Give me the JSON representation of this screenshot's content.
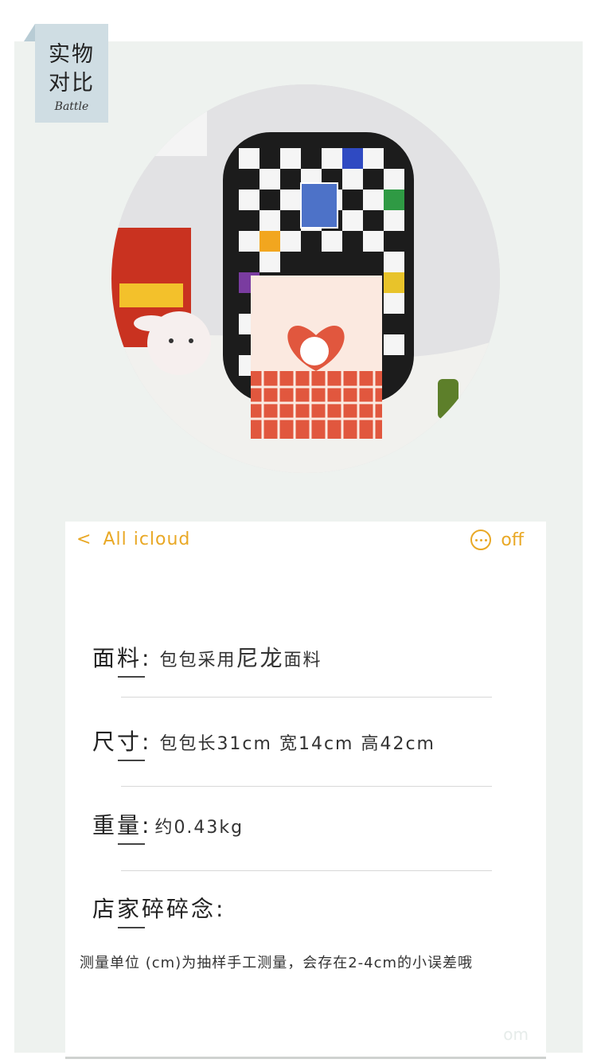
{
  "tag": {
    "title_line1": "实物",
    "title_line2": "对比",
    "subtitle": "Battle"
  },
  "photo": {
    "description_icon": "product-photo-backpack"
  },
  "card": {
    "header": {
      "back_chevron": "<",
      "back_label": "All icloud",
      "more_label": "off"
    },
    "rows": [
      {
        "label": "面料:",
        "value_prefix": "包包采用",
        "value_big": "尼龙",
        "value_suffix": "面料"
      },
      {
        "label": "尺寸:",
        "value": "包包长31cm 宽14cm 高42cm"
      },
      {
        "label": "重量:",
        "value": "约0.43kg"
      },
      {
        "label": "店家碎碎念:"
      }
    ],
    "note": "测量单位 (cm)为抽样手工测量，会存在2-4cm的小误差哦"
  },
  "colors": {
    "accent": "#e9a825",
    "panel_bg": "#eef2ef",
    "tag_bg": "#cfdde3"
  },
  "watermark": "om"
}
